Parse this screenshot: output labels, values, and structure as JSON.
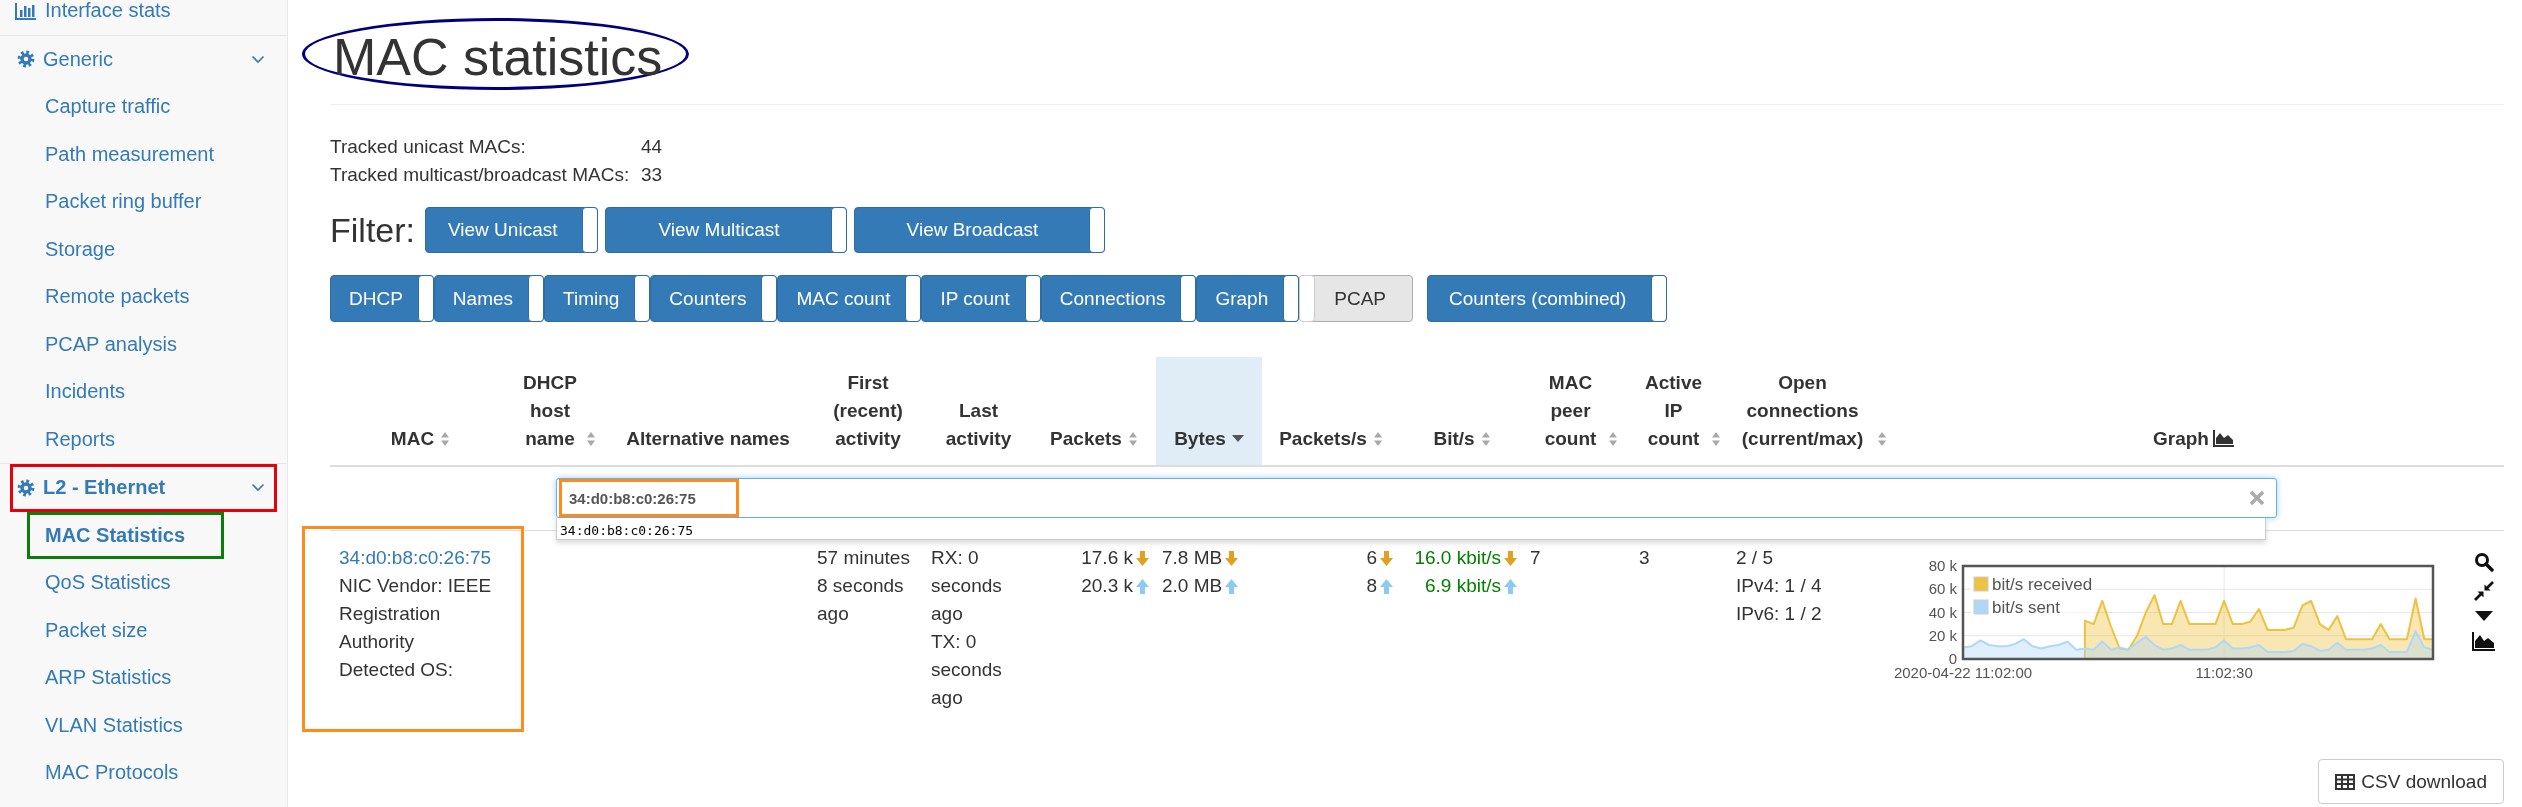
{
  "sidebar": {
    "items": [
      {
        "kind": "link",
        "label": "Interface stats",
        "selected": false
      },
      {
        "kind": "group",
        "label": "Generic",
        "expanded": true,
        "selected": false,
        "children": [
          {
            "label": "Capture traffic",
            "selected": false
          },
          {
            "label": "Path measurement",
            "selected": false
          },
          {
            "label": "Packet ring buffer",
            "selected": false
          },
          {
            "label": "Storage",
            "selected": false
          },
          {
            "label": "Remote packets",
            "selected": false
          },
          {
            "label": "PCAP analysis",
            "selected": false
          },
          {
            "label": "Incidents",
            "selected": false
          },
          {
            "label": "Reports",
            "selected": false
          }
        ]
      },
      {
        "kind": "group",
        "label": "L2 - Ethernet",
        "expanded": true,
        "selected": true,
        "highlight": {
          "color": "#e8000b"
        },
        "children": [
          {
            "label": "MAC Statistics",
            "selected": true,
            "highlight": {
              "color": "#0a7d0a"
            }
          },
          {
            "label": "QoS Statistics",
            "selected": false
          },
          {
            "label": "Packet size",
            "selected": false
          },
          {
            "label": "ARP Statistics",
            "selected": false
          },
          {
            "label": "VLAN Statistics",
            "selected": false
          },
          {
            "label": "MAC Protocols",
            "selected": false
          }
        ]
      }
    ]
  },
  "page": {
    "title": "MAC statistics",
    "highlight": {
      "color": "#00007f"
    },
    "stats": [
      {
        "label": "Tracked unicast MACs:",
        "value": "44"
      },
      {
        "label": "Tracked multicast/broadcast MACs:",
        "value": "33"
      }
    ]
  },
  "filter": {
    "label": "Filter:",
    "buttons": [
      {
        "label": "View Unicast",
        "on": true
      },
      {
        "label": "View Multicast",
        "on": true
      },
      {
        "label": "View Broadcast",
        "on": true
      }
    ]
  },
  "column_toggles": [
    {
      "label": "DHCP",
      "on": true
    },
    {
      "label": "Names",
      "on": true
    },
    {
      "label": "Timing",
      "on": true
    },
    {
      "label": "Counters",
      "on": true
    },
    {
      "label": "MAC count",
      "on": true
    },
    {
      "label": "IP count",
      "on": true
    },
    {
      "label": "Connections",
      "on": true
    },
    {
      "label": "Graph",
      "on": true
    },
    {
      "label": "PCAP",
      "on": false
    }
  ],
  "combined_toggle": {
    "label": "Counters (combined)",
    "on": true
  },
  "table": {
    "columns": [
      {
        "label": "MAC",
        "kind": "text",
        "sortable": true,
        "sorted": false
      },
      {
        "label": "DHCP host name",
        "kind": "text",
        "sortable": true,
        "sorted": false
      },
      {
        "label": "Alternative names",
        "kind": "text",
        "sortable": false,
        "sorted": false
      },
      {
        "label": "First (recent) activity",
        "kind": "text",
        "sortable": false,
        "sorted": false
      },
      {
        "label": "Last activity",
        "kind": "text",
        "sortable": false,
        "sorted": false
      },
      {
        "label": "Packets",
        "kind": "text",
        "sortable": true,
        "sorted": false
      },
      {
        "label": "Bytes",
        "kind": "text",
        "sortable": true,
        "sorted": true
      },
      {
        "label": "Packets/s",
        "kind": "text",
        "sortable": true,
        "sorted": false
      },
      {
        "label": "Bit/s",
        "kind": "text",
        "sortable": true,
        "sorted": false
      },
      {
        "label": "MAC peer count",
        "kind": "text",
        "sortable": true,
        "sorted": false
      },
      {
        "label": "Active IP count",
        "kind": "text",
        "sortable": true,
        "sorted": false
      },
      {
        "label": "Open connections (current/max)",
        "kind": "text",
        "sortable": true,
        "sorted": false
      },
      {
        "label": "Graph",
        "kind": "graph",
        "sortable": false,
        "sorted": false
      }
    ],
    "search": {
      "value": "34:d0:b8:c0:26:75",
      "highlight": {
        "color": "#ff8c1a"
      },
      "suggestions": [
        "34:d0:b8:c0:26:75"
      ]
    },
    "rows": [
      {
        "mac": "34:d0:b8:c0:26:75",
        "highlight": {
          "color": "#ff8c1a"
        },
        "vendor": "NIC Vendor: IEEE Registration Authority",
        "os": "Detected OS:",
        "first_activity": "57 minutes 8 seconds ago",
        "last_activity": [
          "RX: 0 seconds ago",
          "TX: 0 seconds ago"
        ],
        "packets": [
          {
            "value": "17.6 k",
            "kind": "received"
          },
          {
            "value": "20.3 k",
            "kind": "sent"
          }
        ],
        "bytes": [
          {
            "value": "7.8 MB",
            "kind": "received"
          },
          {
            "value": "2.0 MB",
            "kind": "sent"
          }
        ],
        "packets_per_s": [
          {
            "value": "6",
            "kind": "received"
          },
          {
            "value": "8",
            "kind": "sent"
          }
        ],
        "bits_per_s": [
          {
            "value": "16.0 kbit/s",
            "kind": "received"
          },
          {
            "value": "6.9 kbit/s",
            "kind": "sent"
          }
        ],
        "mac_peer_count": "7",
        "active_ip_count": "3",
        "open_connections": [
          "2 / 5",
          "IPv4: 1 / 4",
          "IPv6: 1 / 2"
        ],
        "graph": {
          "chart_data": {
            "type": "area",
            "ylim": [
              0,
              80
            ],
            "grid": true,
            "legend": true,
            "categories": [
              "2020-04-22 11:02:00",
              null,
              null,
              null,
              null,
              null,
              null,
              null,
              null,
              null,
              null,
              null,
              null,
              null,
              null,
              null,
              null,
              null,
              null,
              null,
              null,
              null,
              null,
              null,
              null,
              null,
              null,
              null,
              null,
              null,
              "11:02:30",
              null,
              null,
              null,
              null,
              null,
              null,
              null,
              null,
              null,
              null,
              null,
              null,
              null,
              null,
              null,
              null,
              null,
              null,
              null,
              null,
              null,
              null,
              null,
              null
            ],
            "yticks": [
              {
                "value": 0,
                "label": "0"
              },
              {
                "value": 20,
                "label": "20 k"
              },
              {
                "value": 40,
                "label": "40 k"
              },
              {
                "value": 60,
                "label": "60 k"
              },
              {
                "value": 80,
                "label": "80 k"
              }
            ],
            "series": [
              {
                "name": "bit/s received",
                "color": "#edc240",
                "values": [
                  null,
                  null,
                  null,
                  null,
                  null,
                  null,
                  null,
                  null,
                  null,
                  null,
                  null,
                  null,
                  null,
                  null,
                  33,
                  30,
                  50,
                  28,
                  9,
                  8,
                  20,
                  40,
                  55,
                  30,
                  30,
                  50,
                  30,
                  30,
                  30,
                  30,
                  50,
                  30,
                  30,
                  32,
                  43,
                  25,
                  25,
                  25,
                  27,
                  46,
                  50,
                  30,
                  25,
                  37,
                  17,
                  17,
                  17,
                  17,
                  30,
                  17,
                  17,
                  17,
                  52,
                  17,
                  17
                ]
              },
              {
                "name": "bit/s sent",
                "color": "#afd8f8",
                "values": [
                  10,
                  11,
                  16,
                  12,
                  11,
                  11,
                  13,
                  17,
                  11,
                  9,
                  11,
                  12,
                  15,
                  8,
                  9,
                  8,
                  15,
                  8,
                  10,
                  8,
                  14,
                  19,
                  12,
                  8,
                  9,
                  12,
                  8,
                  8,
                  8,
                  10,
                  16,
                  9,
                  9,
                  10,
                  12,
                  6,
                  6,
                  6,
                  7,
                  13,
                  11,
                  7,
                  8,
                  14,
                  8,
                  8,
                  8,
                  9,
                  12,
                  6,
                  6,
                  6,
                  24,
                  10,
                  8
                ]
              }
            ]
          }
        }
      }
    ]
  },
  "csv_button": {
    "label": "CSV download"
  }
}
